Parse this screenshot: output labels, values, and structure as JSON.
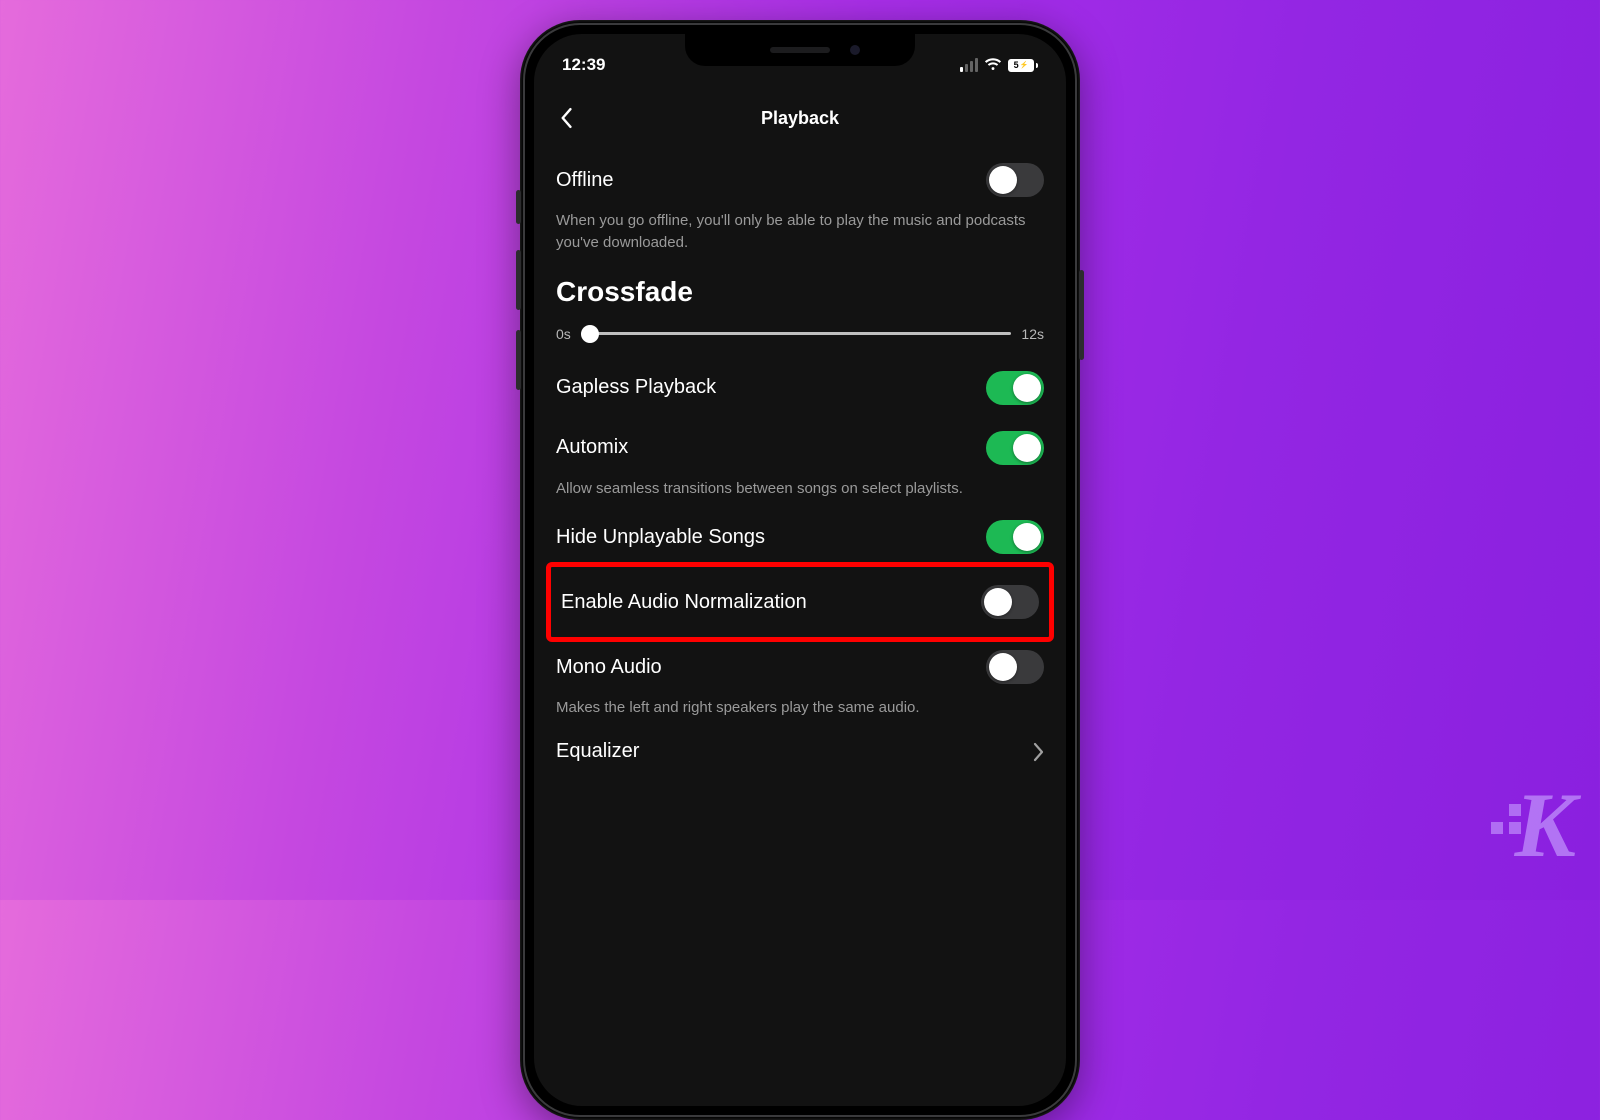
{
  "statusbar": {
    "time": "12:39",
    "battery": "5"
  },
  "header": {
    "title": "Playback"
  },
  "offline": {
    "label": "Offline",
    "desc": "When you go offline, you'll only be able to play the music and podcasts you've downloaded.",
    "enabled": false
  },
  "crossfade": {
    "title": "Crossfade",
    "min_label": "0s",
    "max_label": "12s",
    "value": 0
  },
  "gapless": {
    "label": "Gapless Playback",
    "enabled": true
  },
  "automix": {
    "label": "Automix",
    "desc": "Allow seamless transitions between songs on select playlists.",
    "enabled": true
  },
  "hide_unplayable": {
    "label": "Hide Unplayable Songs",
    "enabled": true
  },
  "audio_normalization": {
    "label": "Enable Audio Normalization",
    "enabled": false
  },
  "mono_audio": {
    "label": "Mono Audio",
    "desc": "Makes the left and right speakers play the same audio.",
    "enabled": false
  },
  "equalizer": {
    "label": "Equalizer"
  },
  "watermark": "K"
}
